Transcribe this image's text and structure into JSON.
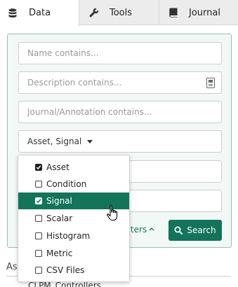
{
  "tabs": [
    {
      "label": "Data",
      "icon": "database-icon",
      "active": true
    },
    {
      "label": "Tools",
      "icon": "wrench-icon",
      "active": false
    },
    {
      "label": "Journal",
      "icon": "journal-icon",
      "active": false
    }
  ],
  "search": {
    "name_placeholder": "Name contains...",
    "description_placeholder": "Description contains...",
    "journal_placeholder": "Journal/Annotation contains...",
    "type_select_value": "Asset, Signal",
    "more_filters_label": "filters",
    "search_button_label": "Search"
  },
  "type_menu": {
    "items": [
      {
        "label": "Asset",
        "checked": true
      },
      {
        "label": "Condition",
        "checked": false
      },
      {
        "label": "Signal",
        "checked": true,
        "highlighted": true
      },
      {
        "label": "Scalar",
        "checked": false
      },
      {
        "label": "Histogram",
        "checked": false
      },
      {
        "label": "Metric",
        "checked": false
      },
      {
        "label": "CSV Files",
        "checked": false
      }
    ]
  },
  "results": {
    "heading": "Assets",
    "first_item": "CLPM_Controllers"
  },
  "colors": {
    "accent": "#13745a",
    "panel_bg": "#f2f8f5",
    "panel_border": "#8fc4ad"
  }
}
